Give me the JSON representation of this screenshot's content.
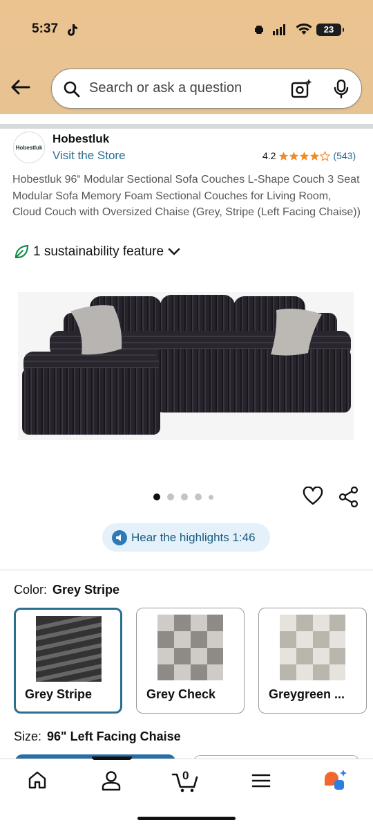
{
  "status_bar": {
    "time": "5:37",
    "battery": "23"
  },
  "search": {
    "placeholder": "Search or ask a question"
  },
  "store": {
    "logo_text": "Hobestluk",
    "brand": "Hobestluk",
    "visit_label": "Visit the Store",
    "rating": "4.2",
    "rating_value": 4.2,
    "review_count": "(543)"
  },
  "product": {
    "title": "Hobestluk 96“ Modular Sectional Sofa Couches L-Shape Couch 3 Seat Modular Sofa Memory Foam Sectional Couches for Living Room, Cloud Couch with Oversized Chaise (Grey, Stripe (Left Facing Chaise))",
    "sustainability": "1 sustainability feature",
    "image_count": 5,
    "active_image": 1
  },
  "highlights": {
    "label": "Hear the highlights 1:46"
  },
  "color": {
    "label": "Color:",
    "selected": "Grey Stripe",
    "options": [
      {
        "label": "Grey Stripe"
      },
      {
        "label": "Grey Check"
      },
      {
        "label": "Greygreen ..."
      }
    ]
  },
  "size": {
    "label": "Size:",
    "selected": "96\" Left Facing Chaise"
  },
  "bottom_nav": {
    "cart_count": "0"
  },
  "colors": {
    "header": "#e8c392",
    "link": "#2a6e91",
    "star": "#f08a24",
    "selected_border": "#2a6e91"
  }
}
